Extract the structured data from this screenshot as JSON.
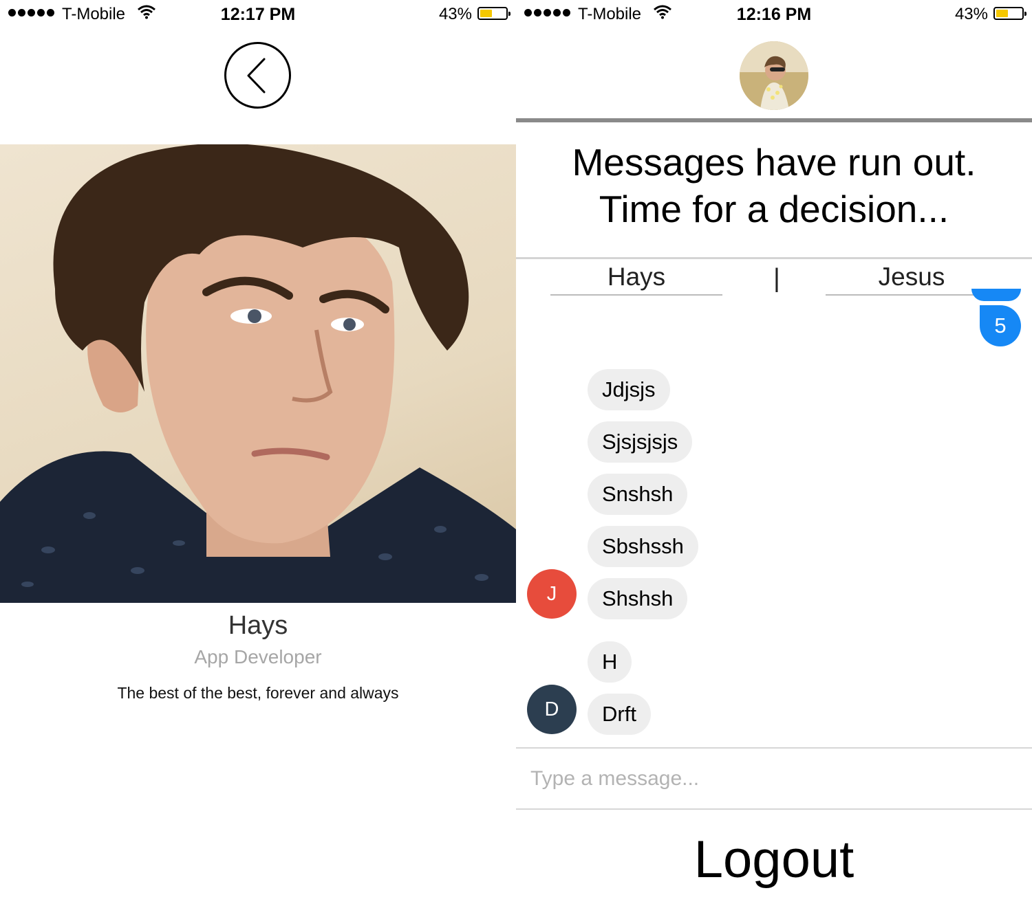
{
  "profile_screen": {
    "status": {
      "carrier": "T-Mobile",
      "time": "12:17 PM",
      "battery": "43%",
      "battery_level": 0.43
    },
    "profile": {
      "name": "Hays",
      "role": "App Developer",
      "bio": "The best of the best, forever and always"
    }
  },
  "chat_screen": {
    "status": {
      "carrier": "T-Mobile",
      "time": "12:16 PM",
      "battery": "43%",
      "battery_level": 0.43
    },
    "headline": {
      "line1": "Messages have run out.",
      "line2": "Time for a decision..."
    },
    "choices": {
      "left": "Hays",
      "separator": "|",
      "right": "Jesus"
    },
    "outgoing_badge": "5",
    "messages": [
      {
        "text": "Jdjsjs"
      },
      {
        "text": "Sjsjsjsjs"
      },
      {
        "text": "Snshsh"
      },
      {
        "text": "Sbshssh"
      },
      {
        "text": "Shshsh",
        "sender_initial": "J"
      },
      {
        "text": "H"
      },
      {
        "text": "Drft",
        "sender_initial": "D"
      }
    ],
    "composer": {
      "placeholder": "Type a message...",
      "value": ""
    },
    "logout_label": "Logout"
  },
  "colors": {
    "accent_blue": "#1688f5",
    "avatar_j": "#e74c3c",
    "avatar_d": "#2c3e50",
    "bubble": "#eeeeee",
    "battery": "#f5c800"
  }
}
